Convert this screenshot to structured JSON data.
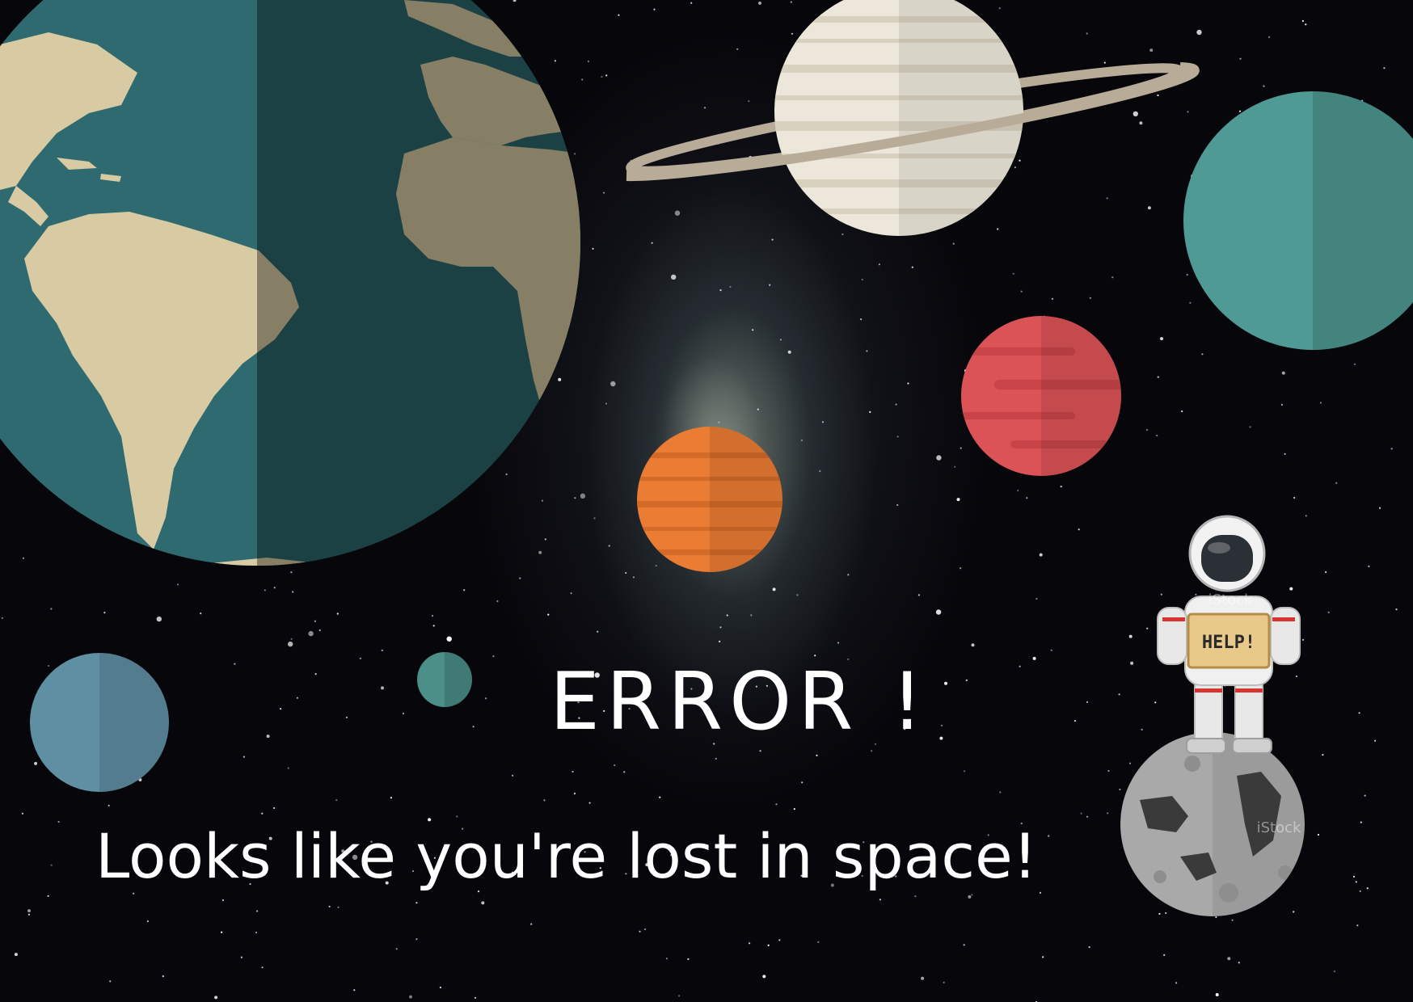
{
  "error": {
    "headline": "ERROR !",
    "message": "Looks like you're lost in space!"
  },
  "astronaut": {
    "sign_text": "HELP!",
    "watermark": "iStock"
  },
  "colors": {
    "background": "#07060b",
    "text": "#ffffff",
    "earth_ocean": "#2e6a70",
    "earth_land": "#d8cba4",
    "saturn": "#ece7da",
    "teal_planet": "#4f9a94",
    "red_planet": "#dc5357",
    "orange_planet": "#ea7c34",
    "blue_planet": "#5f8fa3",
    "moon": "#a9a9a9"
  }
}
